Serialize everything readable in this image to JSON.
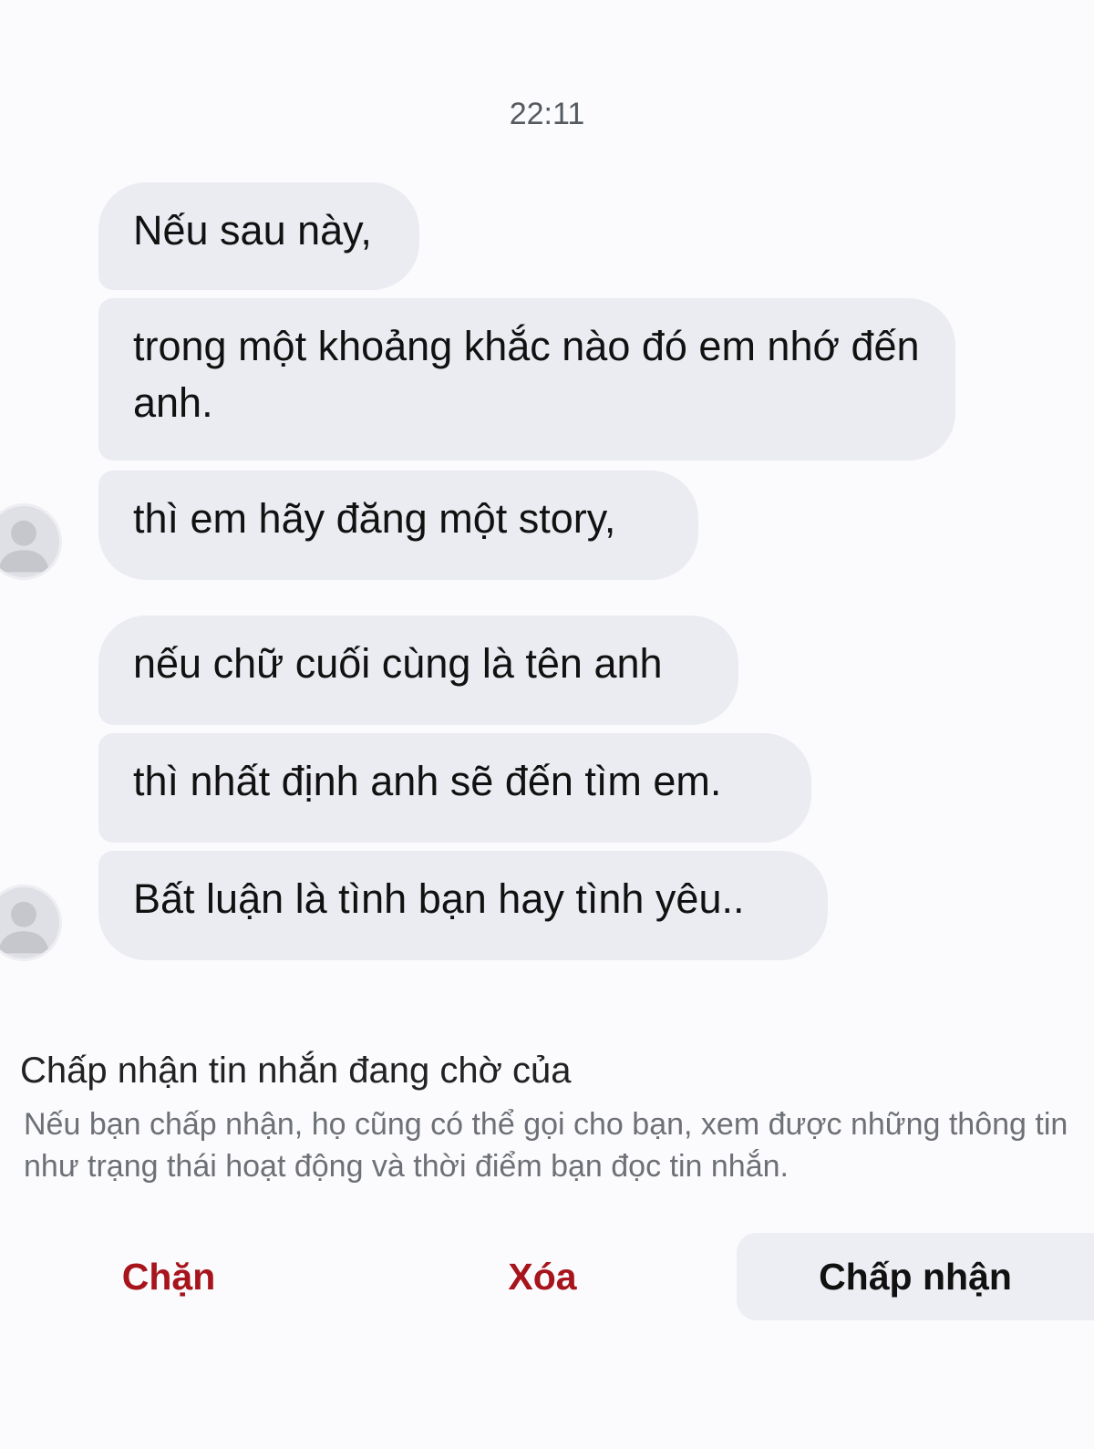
{
  "conversation": {
    "timestamp": "22:11",
    "messages": [
      {
        "text": "Nếu sau này,"
      },
      {
        "text": "trong một khoảng khắc nào đó em nhớ đến anh."
      },
      {
        "text": "thì em hãy đăng một story,"
      },
      {
        "text": "nếu chữ cuối cùng là tên anh"
      },
      {
        "text": "thì nhất định anh sẽ đến tìm em."
      },
      {
        "text": "Bất luận là tình bạn hay tình yêu.."
      }
    ]
  },
  "request_panel": {
    "title": "Chấp nhận tin nhắn đang chờ của",
    "description": "Nếu bạn chấp nhận, họ cũng có thể gọi cho bạn, xem được những thông tin như trạng thái hoạt động và thời điểm bạn đọc tin nhắn."
  },
  "actions": {
    "block": "Chặn",
    "delete": "Xóa",
    "accept": "Chấp nhận"
  },
  "colors": {
    "destructive": "#a7141c",
    "bubble": "#ebecf2",
    "background": "#fbfbfd"
  },
  "icons": {
    "avatar": "default-profile-icon"
  }
}
